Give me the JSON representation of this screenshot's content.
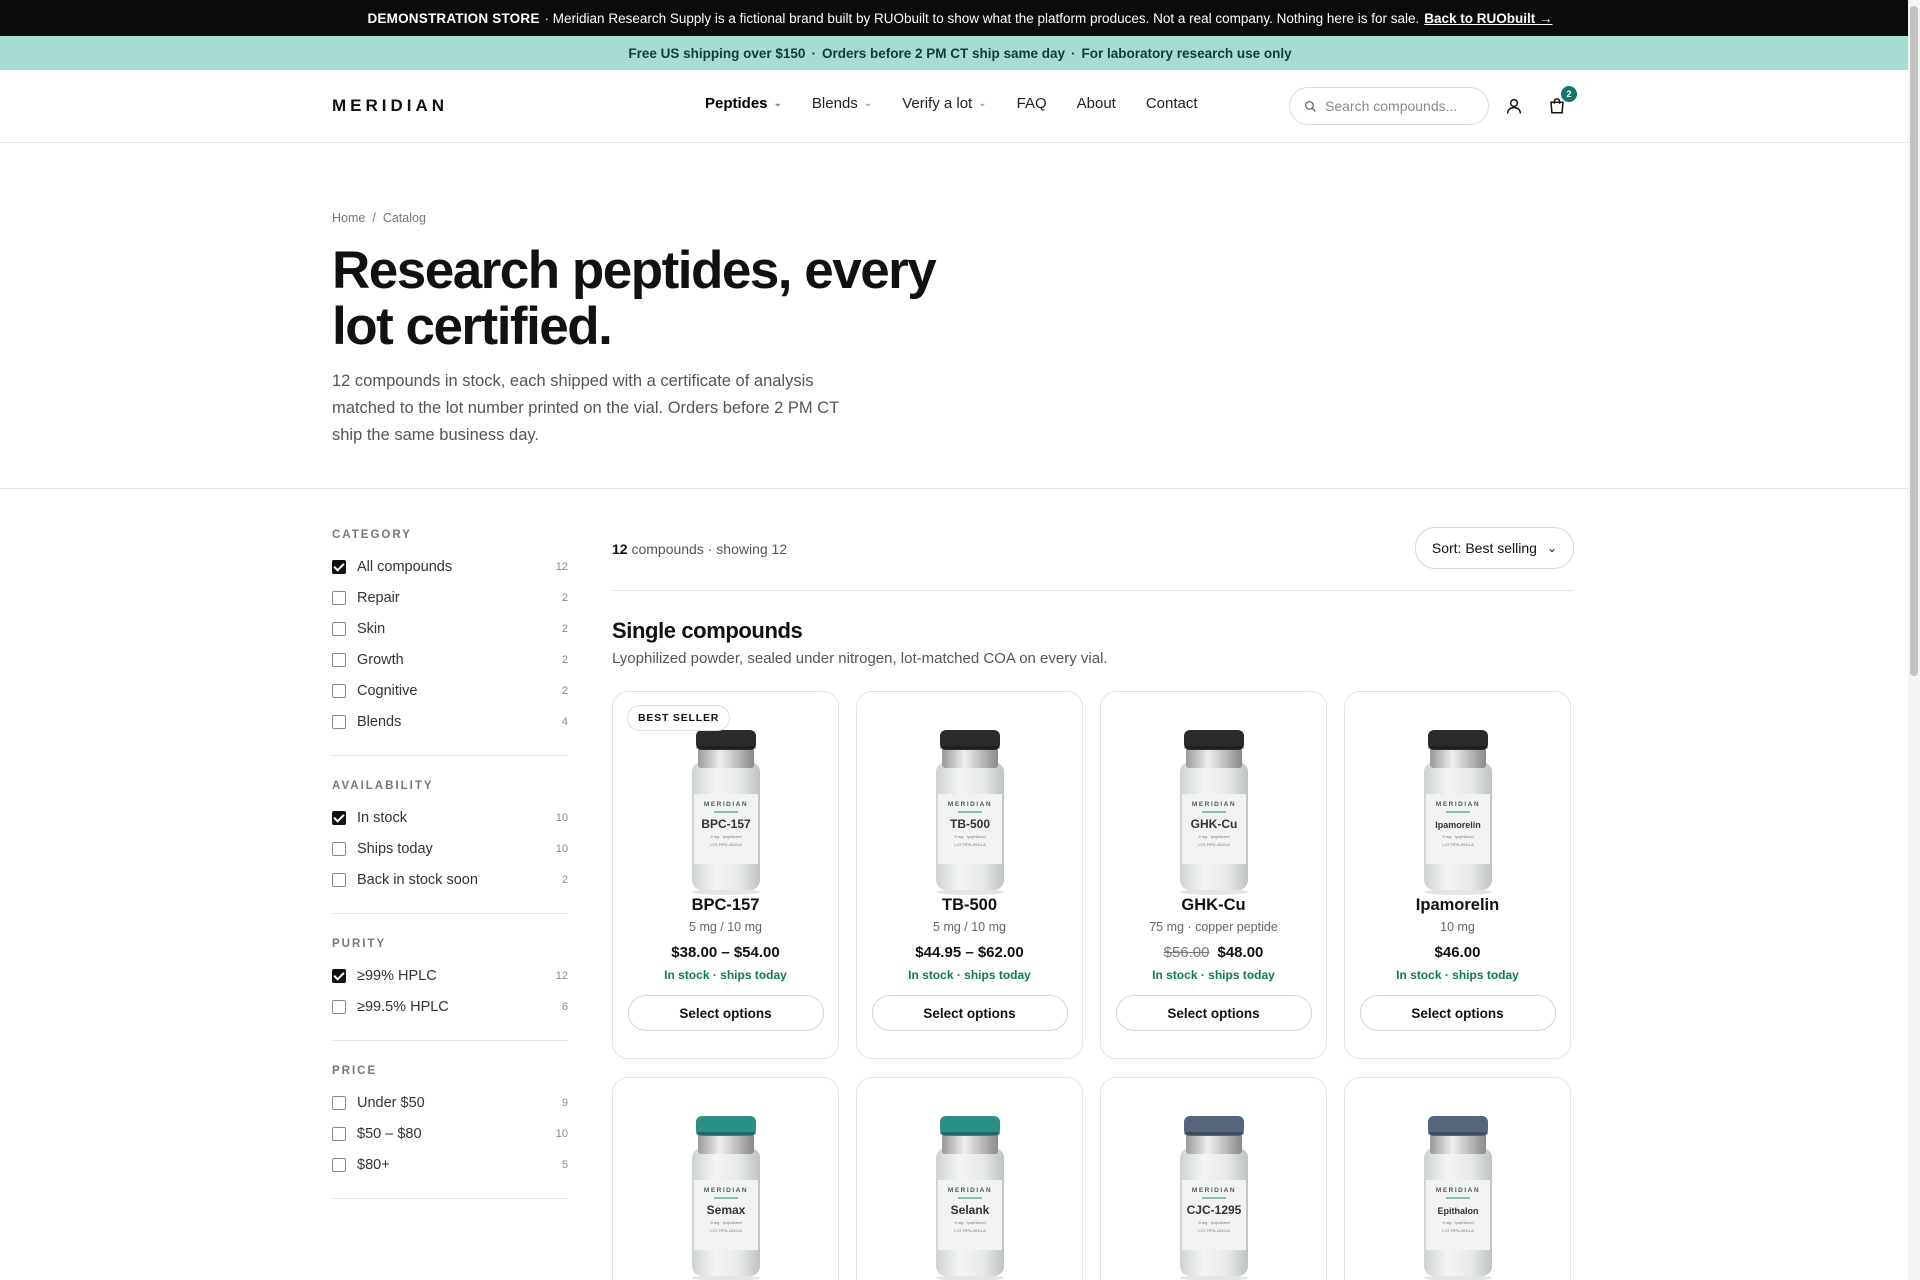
{
  "demo_bar": {
    "label": "DEMONSTRATION STORE",
    "text": "· Meridian Research Supply is a fictional brand built by RUObuilt to show what the platform produces. Not a real company. Nothing here is for sale.",
    "link": "Back to RUObuilt →"
  },
  "promo_bar": {
    "items": [
      "Free US shipping over $150",
      "·",
      "Orders before 2 PM CT ship same day",
      "·",
      "For laboratory research use only"
    ]
  },
  "header": {
    "logo": "MERIDIAN",
    "nav": [
      {
        "label": "Peptides",
        "dropdown": true
      },
      {
        "label": "Blends",
        "dropdown": true
      },
      {
        "label": "Verify a lot",
        "dropdown": true
      },
      {
        "label": "FAQ"
      },
      {
        "label": "About"
      },
      {
        "label": "Contact"
      }
    ],
    "search_placeholder": "Search compounds...",
    "cart_count": "2"
  },
  "breadcrumb": [
    "Home",
    "/",
    "Catalog"
  ],
  "hero": {
    "title": "Research peptides, every lot certified.",
    "description": "12 compounds in stock, each shipped with a certificate of analysis matched to the lot number printed on the vial. Orders before 2 PM CT ship the same business day."
  },
  "filters": [
    {
      "heading": "CATEGORY",
      "options": [
        {
          "label": "All compounds",
          "count": "12",
          "checked": true
        },
        {
          "label": "Repair",
          "count": "2"
        },
        {
          "label": "Skin",
          "count": "2"
        },
        {
          "label": "Growth",
          "count": "2"
        },
        {
          "label": "Cognitive",
          "count": "2"
        },
        {
          "label": "Blends",
          "count": "4"
        }
      ]
    },
    {
      "heading": "AVAILABILITY",
      "options": [
        {
          "label": "In stock",
          "count": "10",
          "checked": true
        },
        {
          "label": "Ships today",
          "count": "10"
        },
        {
          "label": "Back in stock soon",
          "count": "2"
        }
      ]
    },
    {
      "heading": "PURITY",
      "options": [
        {
          "label": "≥99% HPLC",
          "count": "12",
          "checked": true
        },
        {
          "label": "≥99.5% HPLC",
          "count": "6"
        }
      ]
    },
    {
      "heading": "PRICE",
      "options": [
        {
          "label": "Under $50",
          "count": "9"
        },
        {
          "label": "$50 – $80",
          "count": "10"
        },
        {
          "label": "$80+",
          "count": "5"
        }
      ]
    }
  ],
  "results": {
    "count": "12",
    "count_suffix": "compounds · showing 12",
    "sort_label": "Sort: Best selling"
  },
  "section": {
    "title": "Single compounds",
    "subtitle": "Lyophilized powder, sealed under nitrogen, lot-matched COA on every vial."
  },
  "products": [
    {
      "name": "BPC-157",
      "spec": "5 mg / 10 mg",
      "price": "$38.00 – $54.00",
      "stock": "In stock · ships today",
      "button": "Select options",
      "tag": "BEST SELLER",
      "cap": "#2b2b2b"
    },
    {
      "name": "TB-500",
      "spec": "5 mg / 10 mg",
      "price": "$44.95 – $62.00",
      "stock": "In stock · ships today",
      "button": "Select options",
      "cap": "#2b2b2b"
    },
    {
      "name": "GHK-Cu",
      "spec": "75 mg · copper peptide",
      "old_price": "$56.00",
      "price": "$48.00",
      "stock": "In stock · ships today",
      "button": "Select options",
      "cap": "#2b2b2b"
    },
    {
      "name": "Ipamorelin",
      "spec": "10 mg",
      "price": "$46.00",
      "stock": "In stock · ships today",
      "button": "Select options",
      "cap": "#2b2b2b"
    },
    {
      "name": "Semax",
      "cap": "#2a8f84"
    },
    {
      "name": "Selank",
      "cap": "#2a8f84"
    },
    {
      "name": "CJC-1295",
      "cap": "#56657a"
    },
    {
      "name": "Epithalon",
      "cap": "#56657a"
    }
  ],
  "vial_label": {
    "brand": "MERIDIAN",
    "line1": "5 mg · lyophilized",
    "line2": "LOT RPD-2610-A"
  },
  "colors": {
    "accent": "#0e7a69",
    "promo_bg": "#a6ddd3",
    "stock_green": "#0e7a56"
  }
}
